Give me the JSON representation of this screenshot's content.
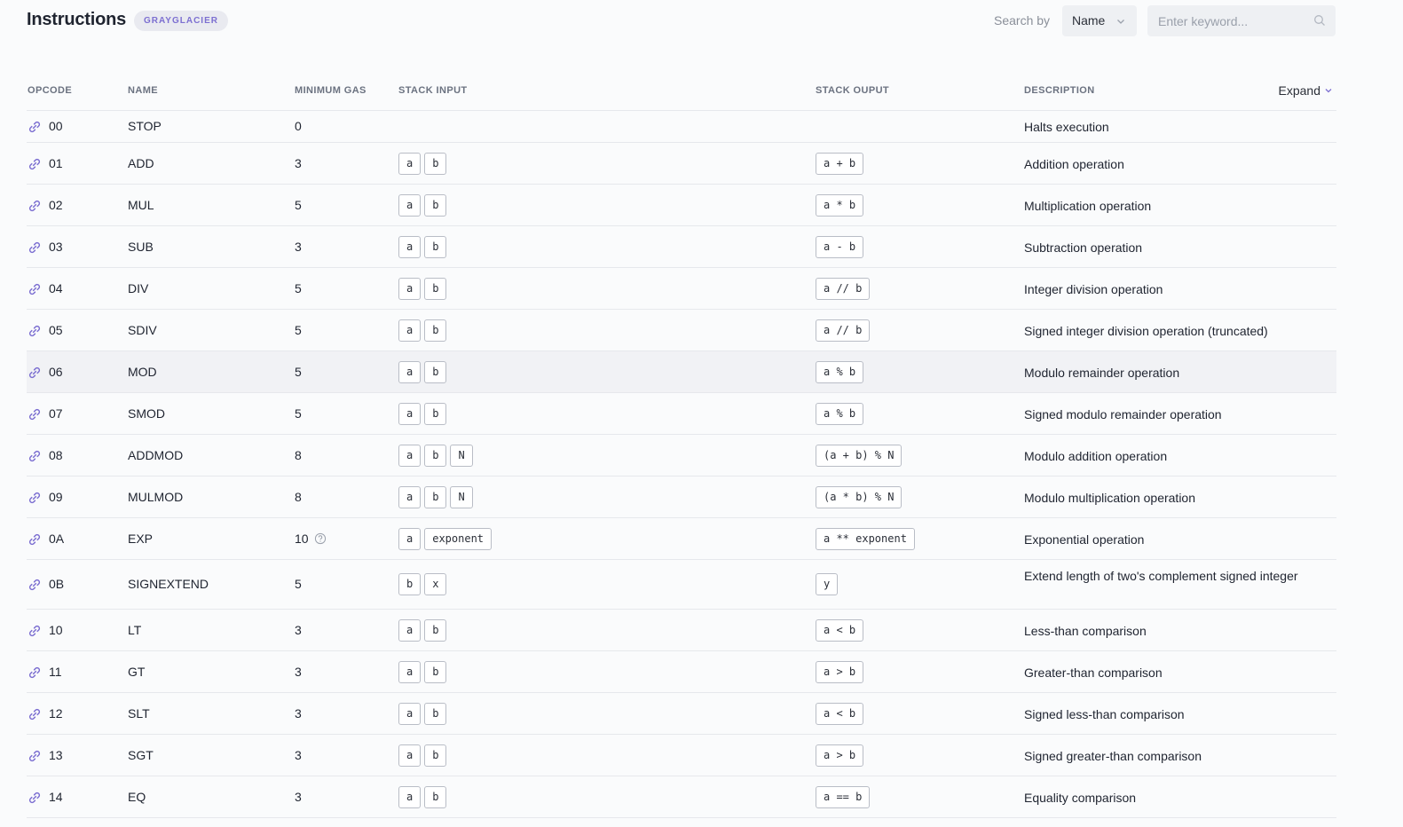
{
  "header": {
    "title": "Instructions",
    "badge": "GRAYGLACIER",
    "search_by_label": "Search by",
    "search_by_value": "Name",
    "search_placeholder": "Enter keyword..."
  },
  "table": {
    "columns": {
      "opcode": "OPCODE",
      "name": "NAME",
      "gas": "MINIMUM GAS",
      "input": "STACK INPUT",
      "output": "STACK OUPUT",
      "desc": "DESCRIPTION"
    },
    "expand_label": "Expand",
    "rows": [
      {
        "opcode": "00",
        "name": "STOP",
        "gas": "0",
        "inputs": [],
        "outputs": [],
        "desc": "Halts execution"
      },
      {
        "opcode": "01",
        "name": "ADD",
        "gas": "3",
        "inputs": [
          "a",
          "b"
        ],
        "outputs": [
          "a + b"
        ],
        "desc": "Addition operation"
      },
      {
        "opcode": "02",
        "name": "MUL",
        "gas": "5",
        "inputs": [
          "a",
          "b"
        ],
        "outputs": [
          "a * b"
        ],
        "desc": "Multiplication operation"
      },
      {
        "opcode": "03",
        "name": "SUB",
        "gas": "3",
        "inputs": [
          "a",
          "b"
        ],
        "outputs": [
          "a - b"
        ],
        "desc": "Subtraction operation"
      },
      {
        "opcode": "04",
        "name": "DIV",
        "gas": "5",
        "inputs": [
          "a",
          "b"
        ],
        "outputs": [
          "a // b"
        ],
        "desc": "Integer division operation"
      },
      {
        "opcode": "05",
        "name": "SDIV",
        "gas": "5",
        "inputs": [
          "a",
          "b"
        ],
        "outputs": [
          "a // b"
        ],
        "desc": "Signed integer division operation (truncated)"
      },
      {
        "opcode": "06",
        "name": "MOD",
        "gas": "5",
        "inputs": [
          "a",
          "b"
        ],
        "outputs": [
          "a % b"
        ],
        "desc": "Modulo remainder operation",
        "highlighted": true
      },
      {
        "opcode": "07",
        "name": "SMOD",
        "gas": "5",
        "inputs": [
          "a",
          "b"
        ],
        "outputs": [
          "a % b"
        ],
        "desc": "Signed modulo remainder operation"
      },
      {
        "opcode": "08",
        "name": "ADDMOD",
        "gas": "8",
        "inputs": [
          "a",
          "b",
          "N"
        ],
        "outputs": [
          "(a + b) % N"
        ],
        "desc": "Modulo addition operation"
      },
      {
        "opcode": "09",
        "name": "MULMOD",
        "gas": "8",
        "inputs": [
          "a",
          "b",
          "N"
        ],
        "outputs": [
          "(a * b) % N"
        ],
        "desc": "Modulo multiplication operation"
      },
      {
        "opcode": "0A",
        "name": "EXP",
        "gas": "10",
        "gas_info": true,
        "inputs": [
          "a",
          "exponent"
        ],
        "outputs": [
          "a ** exponent"
        ],
        "desc": "Exponential operation"
      },
      {
        "opcode": "0B",
        "name": "SIGNEXTEND",
        "gas": "5",
        "inputs": [
          "b",
          "x"
        ],
        "outputs": [
          "y"
        ],
        "desc": "Extend length of two's complement signed integer"
      },
      {
        "opcode": "10",
        "name": "LT",
        "gas": "3",
        "inputs": [
          "a",
          "b"
        ],
        "outputs": [
          "a < b"
        ],
        "desc": "Less-than comparison"
      },
      {
        "opcode": "11",
        "name": "GT",
        "gas": "3",
        "inputs": [
          "a",
          "b"
        ],
        "outputs": [
          "a > b"
        ],
        "desc": "Greater-than comparison"
      },
      {
        "opcode": "12",
        "name": "SLT",
        "gas": "3",
        "inputs": [
          "a",
          "b"
        ],
        "outputs": [
          "a < b"
        ],
        "desc": "Signed less-than comparison"
      },
      {
        "opcode": "13",
        "name": "SGT",
        "gas": "3",
        "inputs": [
          "a",
          "b"
        ],
        "outputs": [
          "a > b"
        ],
        "desc": "Signed greater-than comparison"
      },
      {
        "opcode": "14",
        "name": "EQ",
        "gas": "3",
        "inputs": [
          "a",
          "b"
        ],
        "outputs": [
          "a == b"
        ],
        "desc": "Equality comparison"
      }
    ]
  },
  "icons": {
    "row_link": "link-icon",
    "select_chevron": "chevron-down-icon",
    "search": "search-icon",
    "gas_info": "help-circle-icon",
    "expand_chevron": "chevron-down-icon"
  },
  "colors": {
    "accent": "#7c6fd1",
    "chip_border": "#b9bdc6",
    "divider": "#e6e8ec",
    "highlight_row": "#f1f2f5"
  }
}
